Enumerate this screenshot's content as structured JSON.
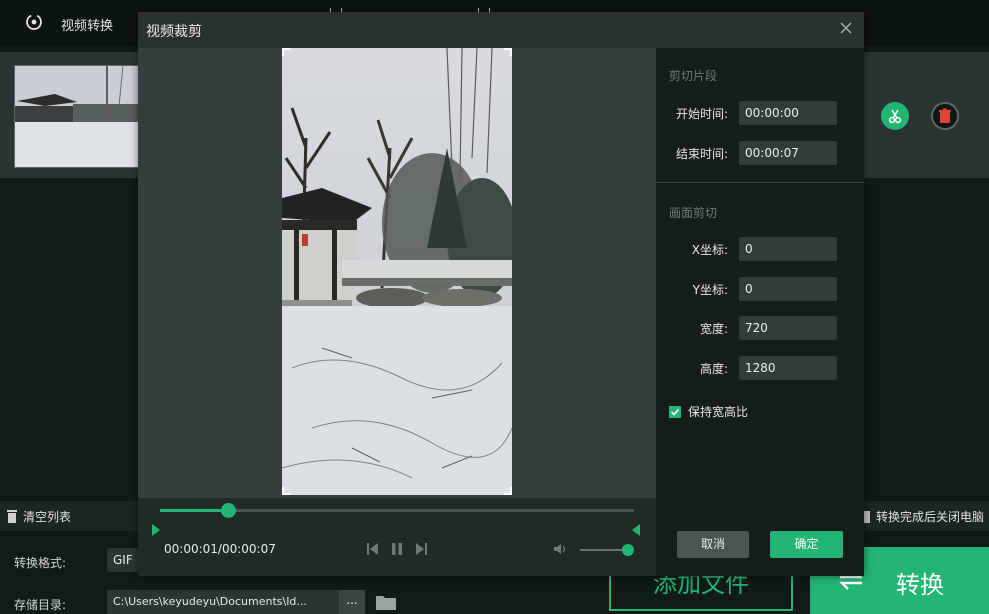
{
  "app": {
    "title": "视频转换",
    "clear_list": "清空列表",
    "shutdown_option": "转换完成后关闭电脑",
    "format_label": "转换格式:",
    "format_value": "GIF",
    "output_dir_label": "存储目录:",
    "output_dir_value": "C:\\Users\\keyudeyu\\Documents\\Id...",
    "browse_label": "...",
    "add_file_label": "添加文件",
    "convert_label": "转换"
  },
  "dialog": {
    "title": "视频裁剪",
    "close_icon": "close-icon",
    "clip_section": {
      "title": "剪切片段",
      "start_label": "开始时间:",
      "start_value": "00:00:00",
      "end_label": "结束时间:",
      "end_value": "00:00:07"
    },
    "crop_section": {
      "title": "画面剪切",
      "x_label": "X坐标:",
      "x_value": "0",
      "y_label": "Y坐标:",
      "y_value": "0",
      "width_label": "宽度:",
      "width_value": "720",
      "height_label": "高度:",
      "height_value": "1280"
    },
    "keep_ratio_label": "保持宽高比",
    "keep_ratio_checked": true,
    "cancel_label": "取消",
    "ok_label": "确定",
    "player": {
      "time_readout": "00:00:01/00:00:07",
      "progress": 0.143,
      "volume": 1.0
    }
  },
  "colors": {
    "accent": "#22b573",
    "dialog_bg": "#343e3c",
    "panel_bg": "#151d1b",
    "app_bg": "#101a18"
  }
}
